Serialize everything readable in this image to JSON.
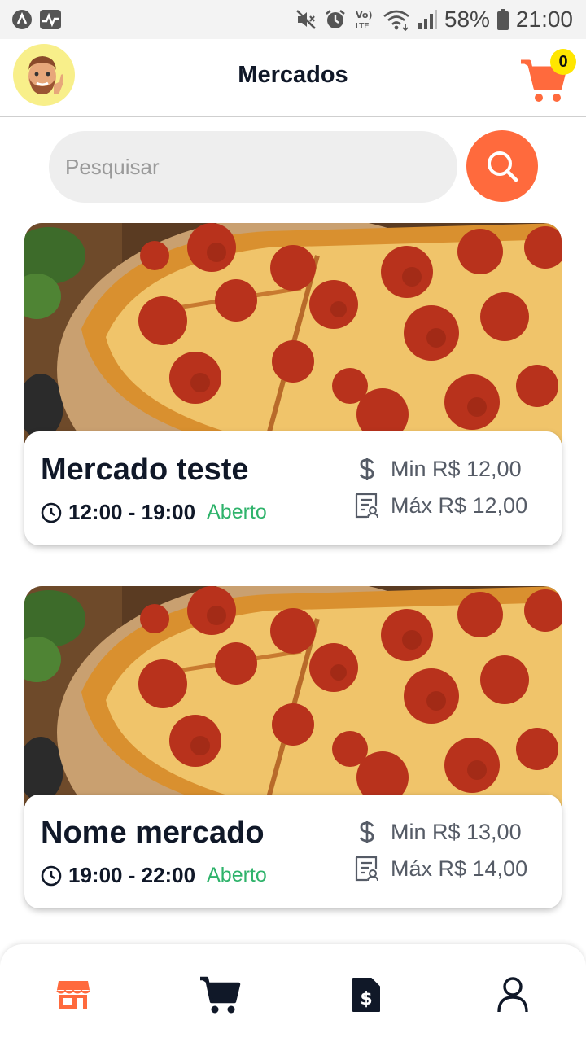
{
  "status_bar": {
    "battery": "58%",
    "time": "21:00",
    "icons": [
      "app-icon",
      "activity-icon",
      "mute-icon",
      "alarm-icon",
      "volte-icon",
      "wifi-icon",
      "signal-icon",
      "battery-icon"
    ]
  },
  "header": {
    "title": "Mercados",
    "cart_count": "0",
    "avatar_icon": "memoji-avatar"
  },
  "search": {
    "placeholder": "Pesquisar",
    "value": "",
    "button_icon": "search-icon"
  },
  "colors": {
    "accent": "#ff6a3d",
    "title": "#101828",
    "open_status": "#2fb36b",
    "badge": "#ffe600",
    "search_bg": "#eeeeee"
  },
  "stores": [
    {
      "name": "Mercado teste",
      "hours": "12:00 - 19:00",
      "status": "Aberto",
      "min_price": "Min R$ 12,00",
      "max_price": "Máx R$ 12,00",
      "image": "pepperoni-pizza-photo"
    },
    {
      "name": "Nome mercado",
      "hours": "19:00 - 22:00",
      "status": "Aberto",
      "min_price": "Min R$ 13,00",
      "max_price": "Máx R$ 14,00",
      "image": "pepperoni-pizza-photo"
    }
  ],
  "bottom_nav": {
    "active": "stores",
    "items": [
      {
        "id": "stores",
        "icon": "store-icon"
      },
      {
        "id": "cart",
        "icon": "cart-icon"
      },
      {
        "id": "orders",
        "icon": "receipt-dollar-icon"
      },
      {
        "id": "profile",
        "icon": "user-icon"
      }
    ]
  }
}
